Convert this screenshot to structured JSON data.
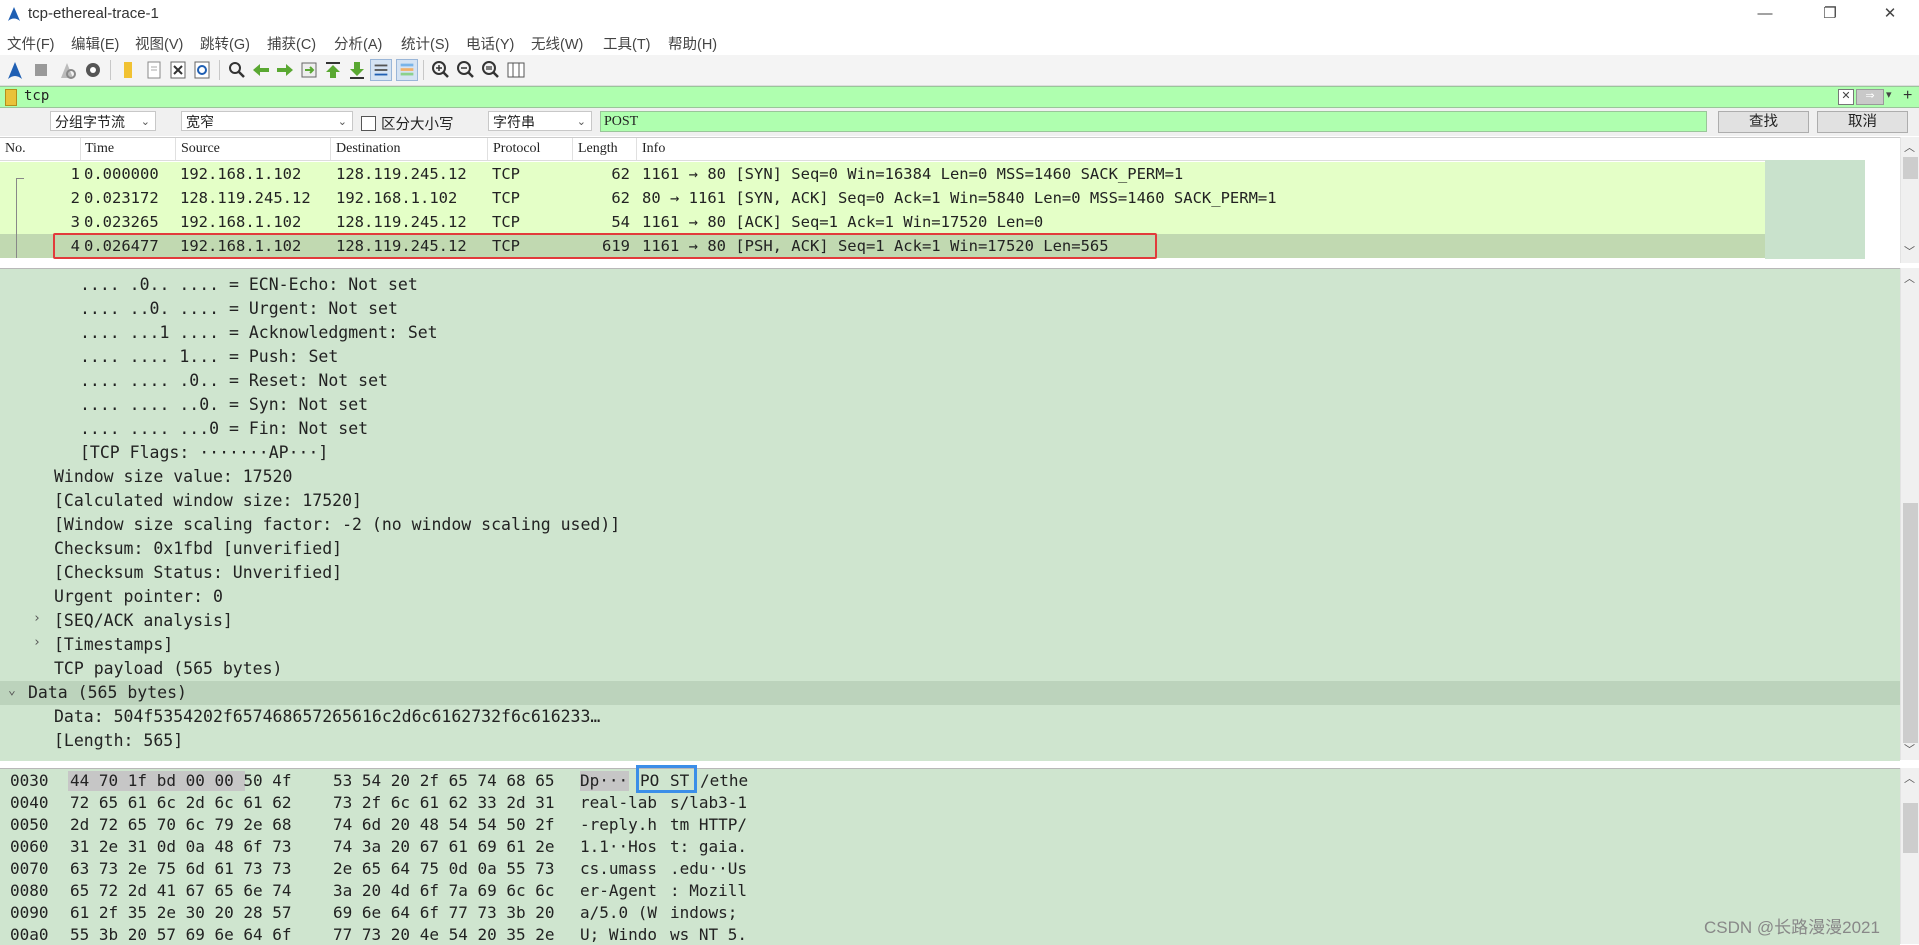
{
  "window": {
    "title": "tcp-ethereal-trace-1",
    "minimize": "—",
    "restore": "❐",
    "close": "✕"
  },
  "menu": [
    "文件(F)",
    "编辑(E)",
    "视图(V)",
    "跳转(G)",
    "捕获(C)",
    "分析(A)",
    "统计(S)",
    "电话(Y)",
    "无线(W)",
    "工具(T)",
    "帮助(H)"
  ],
  "filter": {
    "value": "tcp",
    "clear": "✕",
    "apply": "⇒",
    "dropdown": "▾",
    "add": "+"
  },
  "find": {
    "scope": "分组字节流",
    "charset": "宽窄",
    "case_sensitive_label": "区分大小写",
    "type": "字符串",
    "query": "POST",
    "find_button": "查找",
    "cancel_button": "取消"
  },
  "packet_list": {
    "columns": [
      "No.",
      "Time",
      "Source",
      "Destination",
      "Protocol",
      "Length",
      "Info"
    ],
    "rows": [
      {
        "no": "1",
        "time": "0.000000",
        "src": "192.168.1.102",
        "dst": "128.119.245.12",
        "proto": "TCP",
        "len": "62",
        "info": "1161 → 80 [SYN] Seq=0 Win=16384 Len=0 MSS=1460 SACK_PERM=1"
      },
      {
        "no": "2",
        "time": "0.023172",
        "src": "128.119.245.12",
        "dst": "192.168.1.102",
        "proto": "TCP",
        "len": "62",
        "info": "80 → 1161 [SYN, ACK] Seq=0 Ack=1 Win=5840 Len=0 MSS=1460 SACK_PERM=1"
      },
      {
        "no": "3",
        "time": "0.023265",
        "src": "192.168.1.102",
        "dst": "128.119.245.12",
        "proto": "TCP",
        "len": "54",
        "info": "1161 → 80 [ACK] Seq=1 Ack=1 Win=17520 Len=0"
      },
      {
        "no": "4",
        "time": "0.026477",
        "src": "192.168.1.102",
        "dst": "128.119.245.12",
        "proto": "TCP",
        "len": "619",
        "info": "1161 → 80 [PSH, ACK] Seq=1 Ack=1 Win=17520 Len=565"
      }
    ],
    "selected_row": 4
  },
  "details": [
    {
      "text": ".... .0.. .... = ECN-Echo: Not set",
      "indent": 2
    },
    {
      "text": ".... ..0. .... = Urgent: Not set",
      "indent": 2
    },
    {
      "text": ".... ...1 .... = Acknowledgment: Set",
      "indent": 2
    },
    {
      "text": ".... .... 1... = Push: Set",
      "indent": 2
    },
    {
      "text": ".... .... .0.. = Reset: Not set",
      "indent": 2
    },
    {
      "text": ".... .... ..0. = Syn: Not set",
      "indent": 2
    },
    {
      "text": ".... .... ...0 = Fin: Not set",
      "indent": 2
    },
    {
      "text": "[TCP Flags: ·······AP···]",
      "indent": 2
    },
    {
      "text": "Window size value: 17520",
      "indent": 1
    },
    {
      "text": "[Calculated window size: 17520]",
      "indent": 1
    },
    {
      "text": "[Window size scaling factor: -2 (no window scaling used)]",
      "indent": 1
    },
    {
      "text": "Checksum: 0x1fbd [unverified]",
      "indent": 1
    },
    {
      "text": "[Checksum Status: Unverified]",
      "indent": 1
    },
    {
      "text": "Urgent pointer: 0",
      "indent": 1
    },
    {
      "text": "[SEQ/ACK analysis]",
      "indent": 1,
      "expander": "›"
    },
    {
      "text": "[Timestamps]",
      "indent": 1,
      "expander": "›"
    },
    {
      "text": "TCP payload (565 bytes)",
      "indent": 1
    },
    {
      "text": "Data (565 bytes)",
      "indent": 0,
      "expander": "⌄",
      "highlight": true
    },
    {
      "text": "Data: 504f5354202f657468657265616c2d6c6162732f6c616233…",
      "indent": 1
    },
    {
      "text": "[Length: 565]",
      "indent": 1
    }
  ],
  "bytes": [
    {
      "offset": "0030",
      "hex1": "44 70 1f bd 00 00 50 4f",
      "hex2": "53 54 20 2f 65 74 68 65",
      "ascii1": "Dp···",
      "ascii_hl": "PO",
      "ascii2": "ST",
      "ascii3": "/ethe"
    },
    {
      "offset": "0040",
      "hex1": "72 65 61 6c 2d 6c 61 62",
      "hex2": "73 2f 6c 61 62 33 2d 31",
      "ascii1": "real-lab",
      "ascii2": "s/lab3-1"
    },
    {
      "offset": "0050",
      "hex1": "2d 72 65 70 6c 79 2e 68",
      "hex2": "74 6d 20 48 54 54 50 2f",
      "ascii1": "-reply.h",
      "ascii2": "tm HTTP/"
    },
    {
      "offset": "0060",
      "hex1": "31 2e 31 0d 0a 48 6f 73",
      "hex2": "74 3a 20 67 61 69 61 2e",
      "ascii1": "1.1··Hos",
      "ascii2": "t: gaia."
    },
    {
      "offset": "0070",
      "hex1": "63 73 2e 75 6d 61 73 73",
      "hex2": "2e 65 64 75 0d 0a 55 73",
      "ascii1": "cs.umass",
      "ascii2": ".edu··Us"
    },
    {
      "offset": "0080",
      "hex1": "65 72 2d 41 67 65 6e 74",
      "hex2": "3a 20 4d 6f 7a 69 6c 6c",
      "ascii1": "er-Agent",
      "ascii2": ": Mozill"
    },
    {
      "offset": "0090",
      "hex1": "61 2f 35 2e 30 20 28 57",
      "hex2": "69 6e 64 6f 77 73 3b 20",
      "ascii1": "a/5.0 (W",
      "ascii2": "indows;"
    },
    {
      "offset": "00a0",
      "hex1": "55 3b 20 57 69 6e 64 6f",
      "hex2": "77 73 20 4e 54 20 35 2e",
      "ascii1": "U; Windo",
      "ascii2": "ws NT 5."
    }
  ],
  "watermark": "CSDN @长路漫漫2021"
}
